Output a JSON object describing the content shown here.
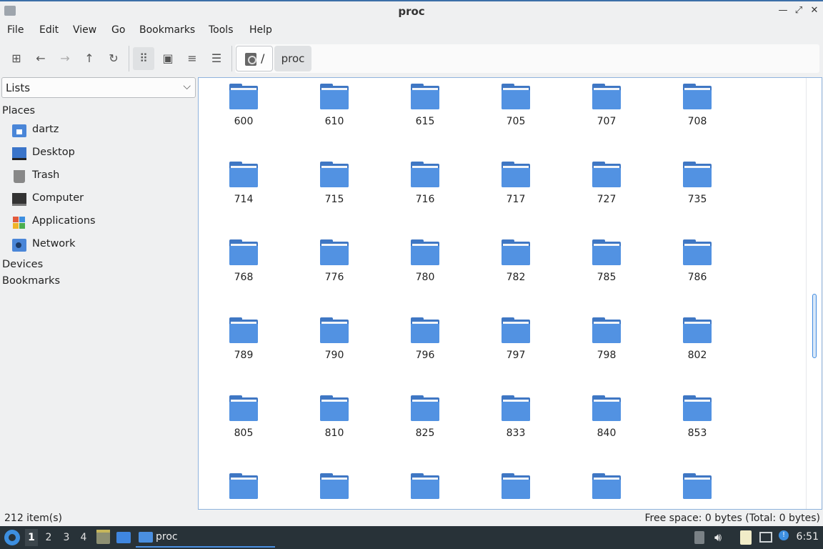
{
  "window": {
    "title": "proc"
  },
  "menu": [
    "File",
    "Edit",
    "View",
    "Go",
    "Bookmarks",
    "Tools",
    "Help"
  ],
  "path": {
    "root": "/",
    "current": "proc"
  },
  "sidebar": {
    "selector": "Lists",
    "places_header": "Places",
    "places": [
      {
        "label": "dartz",
        "icon": "home-folder-icon"
      },
      {
        "label": "Desktop",
        "icon": "desktop-icon"
      },
      {
        "label": "Trash",
        "icon": "trash-icon"
      },
      {
        "label": "Computer",
        "icon": "computer-icon"
      },
      {
        "label": "Applications",
        "icon": "applications-icon"
      },
      {
        "label": "Network",
        "icon": "network-icon"
      }
    ],
    "devices_header": "Devices",
    "bookmarks_header": "Bookmarks"
  },
  "files": {
    "rows": [
      [
        "600",
        "610",
        "615",
        "705",
        "707",
        "708"
      ],
      [
        "714",
        "715",
        "716",
        "717",
        "727",
        "735"
      ],
      [
        "768",
        "776",
        "780",
        "782",
        "785",
        "786"
      ],
      [
        "789",
        "790",
        "796",
        "797",
        "798",
        "802"
      ],
      [
        "805",
        "810",
        "825",
        "833",
        "840",
        "853"
      ],
      [
        "",
        "",
        "",
        "",
        "",
        ""
      ]
    ]
  },
  "status": {
    "items": "212 item(s)",
    "free_space": "Free space: 0 bytes (Total: 0 bytes)"
  },
  "taskbar": {
    "workspaces": [
      "1",
      "2",
      "3",
      "4"
    ],
    "active_workspace": "1",
    "task_label": "proc",
    "clock": "6:51"
  },
  "colors": {
    "folder": "#5292e2",
    "accent": "#3c6fa8",
    "taskbar": "#283238"
  }
}
